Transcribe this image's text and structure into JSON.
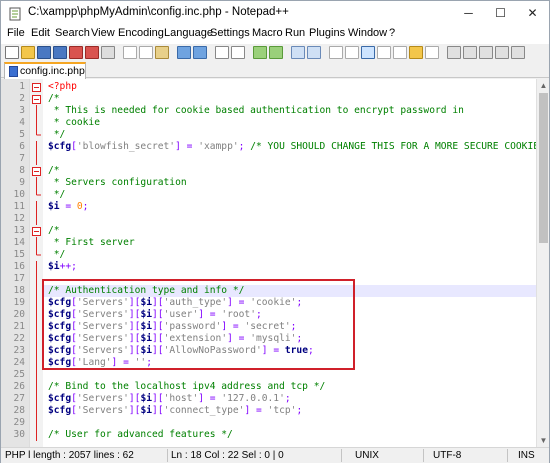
{
  "window": {
    "title": "C:\\xampp\\phpMyAdmin\\config.inc.php - Notepad++"
  },
  "titlebar": {
    "minimize": "─",
    "maximize": "☐",
    "close": "✕"
  },
  "menu": [
    "File",
    "Edit",
    "Search",
    "View",
    "Encoding",
    "Language",
    "Settings",
    "Macro",
    "Run",
    "Plugins",
    "Window",
    "?"
  ],
  "tab": {
    "label": "config.inc.php"
  },
  "editor": {
    "lines": [
      {
        "n": "1",
        "segs": [
          [
            "tagred",
            "<?php"
          ]
        ]
      },
      {
        "n": "2",
        "segs": [
          [
            "cmt",
            "/*"
          ]
        ]
      },
      {
        "n": "3",
        "segs": [
          [
            "cmt",
            " * This is needed for cookie based authentication to encrypt password in"
          ]
        ]
      },
      {
        "n": "4",
        "segs": [
          [
            "cmt",
            " * cookie"
          ]
        ]
      },
      {
        "n": "5",
        "segs": [
          [
            "cmt",
            " */"
          ]
        ]
      },
      {
        "n": "6",
        "segs": [
          [
            "var",
            "$cfg"
          ],
          [
            "op",
            "["
          ],
          [
            "str",
            "'blowfish_secret'"
          ],
          [
            "op",
            "] = "
          ],
          [
            "str",
            "'xampp'"
          ],
          [
            "op",
            "; "
          ],
          [
            "cmt",
            "/* YOU SHOULD CHANGE THIS FOR A MORE SECURE COOKIE"
          ]
        ]
      },
      {
        "n": "7",
        "segs": []
      },
      {
        "n": "8",
        "segs": [
          [
            "cmt",
            "/*"
          ]
        ]
      },
      {
        "n": "9",
        "segs": [
          [
            "cmt",
            " * Servers configuration"
          ]
        ]
      },
      {
        "n": "10",
        "segs": [
          [
            "cmt",
            " */"
          ]
        ]
      },
      {
        "n": "11",
        "segs": [
          [
            "var",
            "$i"
          ],
          [
            "op",
            " = "
          ],
          [
            "num",
            "0"
          ],
          [
            "op",
            ";"
          ]
        ]
      },
      {
        "n": "12",
        "segs": []
      },
      {
        "n": "13",
        "segs": [
          [
            "cmt",
            "/*"
          ]
        ]
      },
      {
        "n": "14",
        "segs": [
          [
            "cmt",
            " * First server"
          ]
        ]
      },
      {
        "n": "15",
        "segs": [
          [
            "cmt",
            " */"
          ]
        ]
      },
      {
        "n": "16",
        "segs": [
          [
            "var",
            "$i"
          ],
          [
            "op",
            "++;"
          ]
        ]
      },
      {
        "n": "17",
        "segs": []
      },
      {
        "n": "18",
        "segs": [
          [
            "cmt",
            "/* Authentication type and info */"
          ]
        ]
      },
      {
        "n": "19",
        "segs": [
          [
            "var",
            "$cfg"
          ],
          [
            "op",
            "["
          ],
          [
            "str",
            "'Servers'"
          ],
          [
            "op",
            "]["
          ],
          [
            "var",
            "$i"
          ],
          [
            "op",
            "]["
          ],
          [
            "str",
            "'auth_type'"
          ],
          [
            "op",
            "] = "
          ],
          [
            "str",
            "'cookie'"
          ],
          [
            "op",
            ";"
          ]
        ]
      },
      {
        "n": "20",
        "segs": [
          [
            "var",
            "$cfg"
          ],
          [
            "op",
            "["
          ],
          [
            "str",
            "'Servers'"
          ],
          [
            "op",
            "]["
          ],
          [
            "var",
            "$i"
          ],
          [
            "op",
            "]["
          ],
          [
            "str",
            "'user'"
          ],
          [
            "op",
            "] = "
          ],
          [
            "str",
            "'root'"
          ],
          [
            "op",
            ";"
          ]
        ]
      },
      {
        "n": "21",
        "segs": [
          [
            "var",
            "$cfg"
          ],
          [
            "op",
            "["
          ],
          [
            "str",
            "'Servers'"
          ],
          [
            "op",
            "]["
          ],
          [
            "var",
            "$i"
          ],
          [
            "op",
            "]["
          ],
          [
            "str",
            "'password'"
          ],
          [
            "op",
            "] = "
          ],
          [
            "str",
            "'secret'"
          ],
          [
            "op",
            ";"
          ]
        ]
      },
      {
        "n": "22",
        "segs": [
          [
            "var",
            "$cfg"
          ],
          [
            "op",
            "["
          ],
          [
            "str",
            "'Servers'"
          ],
          [
            "op",
            "]["
          ],
          [
            "var",
            "$i"
          ],
          [
            "op",
            "]["
          ],
          [
            "str",
            "'extension'"
          ],
          [
            "op",
            "] = "
          ],
          [
            "str",
            "'mysqli'"
          ],
          [
            "op",
            ";"
          ]
        ]
      },
      {
        "n": "23",
        "segs": [
          [
            "var",
            "$cfg"
          ],
          [
            "op",
            "["
          ],
          [
            "str",
            "'Servers'"
          ],
          [
            "op",
            "]["
          ],
          [
            "var",
            "$i"
          ],
          [
            "op",
            "]["
          ],
          [
            "str",
            "'AllowNoPassword'"
          ],
          [
            "op",
            "] = "
          ],
          [
            "kw",
            "true"
          ],
          [
            "op",
            ";"
          ]
        ]
      },
      {
        "n": "24",
        "segs": [
          [
            "var",
            "$cfg"
          ],
          [
            "op",
            "["
          ],
          [
            "str",
            "'Lang'"
          ],
          [
            "op",
            "] = "
          ],
          [
            "str",
            "''"
          ],
          [
            "op",
            ";"
          ]
        ]
      },
      {
        "n": "25",
        "segs": []
      },
      {
        "n": "26",
        "segs": [
          [
            "cmt",
            "/* Bind to the localhost ipv4 address and tcp */"
          ]
        ]
      },
      {
        "n": "27",
        "segs": [
          [
            "var",
            "$cfg"
          ],
          [
            "op",
            "["
          ],
          [
            "str",
            "'Servers'"
          ],
          [
            "op",
            "]["
          ],
          [
            "var",
            "$i"
          ],
          [
            "op",
            "]["
          ],
          [
            "str",
            "'host'"
          ],
          [
            "op",
            "] = "
          ],
          [
            "str",
            "'127.0.0.1'"
          ],
          [
            "op",
            ";"
          ]
        ]
      },
      {
        "n": "28",
        "segs": [
          [
            "var",
            "$cfg"
          ],
          [
            "op",
            "["
          ],
          [
            "str",
            "'Servers'"
          ],
          [
            "op",
            "]["
          ],
          [
            "var",
            "$i"
          ],
          [
            "op",
            "]["
          ],
          [
            "str",
            "'connect_type'"
          ],
          [
            "op",
            "] = "
          ],
          [
            "str",
            "'tcp'"
          ],
          [
            "op",
            ";"
          ]
        ]
      },
      {
        "n": "29",
        "segs": []
      },
      {
        "n": "30",
        "segs": [
          [
            "cmt",
            "/* User for advanced features */"
          ]
        ]
      }
    ]
  },
  "status": {
    "doc_info": "PHP l length : 2057    lines : 62",
    "position": "Ln : 18    Col : 22    Sel : 0 | 0",
    "eol": "UNIX",
    "encoding": "UTF-8",
    "mode": "INS"
  }
}
